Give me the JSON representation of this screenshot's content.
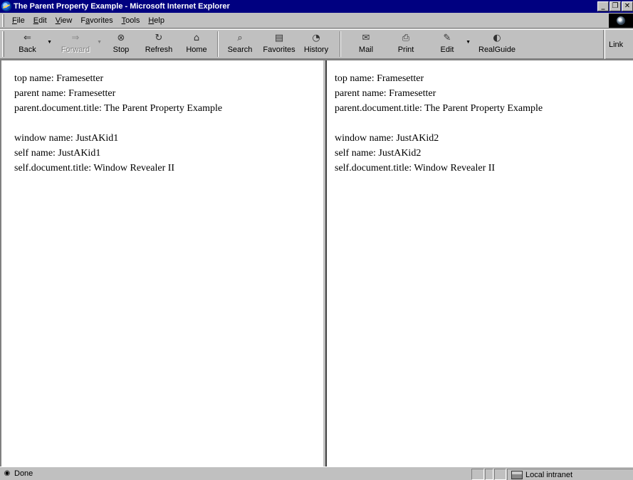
{
  "window": {
    "title": "The Parent Property Example - Microsoft Internet Explorer",
    "controls": {
      "minimize": "_",
      "maximize": "❐",
      "close": "✕"
    }
  },
  "menu": {
    "items": [
      {
        "accel": "F",
        "rest": "ile"
      },
      {
        "accel": "E",
        "rest": "dit"
      },
      {
        "accel": "V",
        "rest": "iew"
      },
      {
        "pre": "F",
        "accel": "a",
        "rest": "vorites"
      },
      {
        "accel": "T",
        "rest": "ools"
      },
      {
        "accel": "H",
        "rest": "elp"
      }
    ]
  },
  "toolbar": {
    "back": {
      "label": "Back",
      "icon": "back-arrow-icon",
      "glyph": "⇐"
    },
    "forward": {
      "label": "Forward",
      "icon": "forward-arrow-icon",
      "glyph": "⇒"
    },
    "stop": {
      "label": "Stop",
      "icon": "stop-icon",
      "glyph": "⊗"
    },
    "refresh": {
      "label": "Refresh",
      "icon": "refresh-icon",
      "glyph": "↻"
    },
    "home": {
      "label": "Home",
      "icon": "home-icon",
      "glyph": "⌂"
    },
    "search": {
      "label": "Search",
      "icon": "search-icon",
      "glyph": "⌕"
    },
    "favorites": {
      "label": "Favorites",
      "icon": "favorites-icon",
      "glyph": "▤"
    },
    "history": {
      "label": "History",
      "icon": "history-icon",
      "glyph": "◔"
    },
    "mail": {
      "label": "Mail",
      "icon": "mail-icon",
      "glyph": "✉"
    },
    "print": {
      "label": "Print",
      "icon": "print-icon",
      "glyph": "⎙"
    },
    "edit": {
      "label": "Edit",
      "icon": "edit-icon",
      "glyph": "✎"
    },
    "realguide": {
      "label": "RealGuide",
      "icon": "realguide-icon",
      "glyph": "◐"
    },
    "links": "Link"
  },
  "frames": {
    "left": {
      "top_name": "top name: Framesetter",
      "parent_name": "parent name: Framesetter",
      "parent_title": "parent.document.title: The Parent Property Example",
      "window_name": "window name: JustAKid1",
      "self_name": "self name: JustAKid1",
      "self_title": "self.document.title: Window Revealer II"
    },
    "right": {
      "top_name": "top name: Framesetter",
      "parent_name": "parent name: Framesetter",
      "parent_title": "parent.document.title: The Parent Property Example",
      "window_name": "window name: JustAKid2",
      "self_name": "self name: JustAKid2",
      "self_title": "self.document.title: Window Revealer II"
    }
  },
  "status": {
    "text": "Done",
    "zone": "Local intranet"
  }
}
